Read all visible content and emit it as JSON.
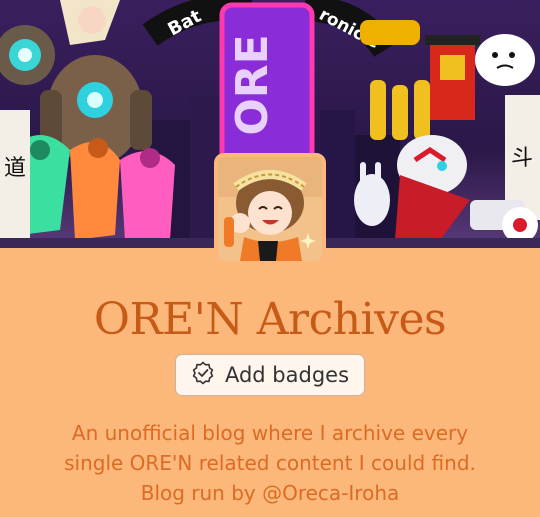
{
  "blog": {
    "title": "ORE'N Archives",
    "add_badges_label": "Add badges",
    "description_lines": [
      "An unofficial blog where I archive every",
      "single ORE'N related content I could find.",
      "Blog run by @Oreca-Iroha"
    ]
  },
  "header": {
    "art_text_top_left": "Bat",
    "art_text_top_right": "ronicle",
    "art_text_center": "ORE",
    "art_text_sign_left": "道",
    "art_text_sign_right": "斗"
  },
  "icons": {
    "badge": "badge-icon"
  },
  "colors": {
    "background": "#fbb87a",
    "title": "#c85a18",
    "description": "#dc6b25",
    "button_bg": "#fff6ee"
  }
}
